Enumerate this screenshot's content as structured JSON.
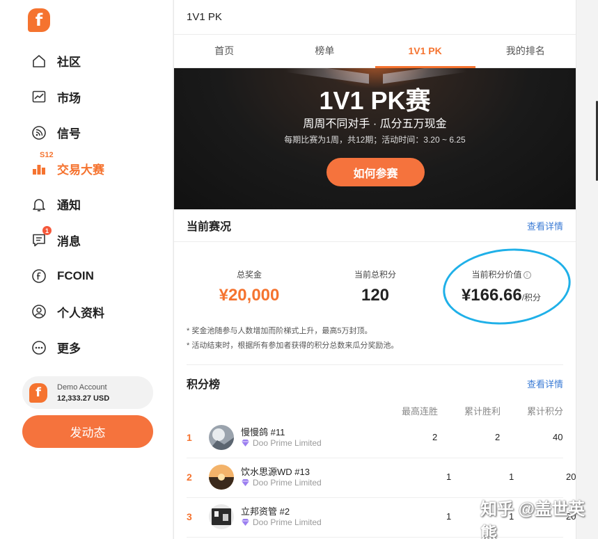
{
  "sidebar": {
    "logo_letter": "f",
    "items": [
      {
        "label": "社区",
        "icon": "home-icon"
      },
      {
        "label": "市场",
        "icon": "chart-icon"
      },
      {
        "label": "信号",
        "icon": "signal-icon"
      },
      {
        "label": "交易大赛",
        "icon": "bar-chart-icon",
        "active": true,
        "tag": "S12"
      },
      {
        "label": "通知",
        "icon": "bell-icon"
      },
      {
        "label": "消息",
        "icon": "message-icon",
        "badge": "1"
      },
      {
        "label": "FCOIN",
        "icon": "fcoin-icon"
      },
      {
        "label": "个人资料",
        "icon": "user-icon"
      },
      {
        "label": "更多",
        "icon": "more-icon"
      }
    ],
    "account": {
      "name": "Demo Account",
      "balance": "12,333.27 USD"
    },
    "post_button": "发动态"
  },
  "header": {
    "title": "1V1 PK"
  },
  "tabs": [
    {
      "label": "首页"
    },
    {
      "label": "榜单"
    },
    {
      "label": "1V1 PK",
      "active": true
    },
    {
      "label": "我的排名"
    }
  ],
  "banner": {
    "title": "1V1 PK赛",
    "subtitle": "周周不同对手 · 瓜分五万现金",
    "info": "每期比赛为1周，共12期；活动时间：3.20 ~ 6.25",
    "button": "如何参赛"
  },
  "status": {
    "title": "当前赛况",
    "link": "查看详情",
    "prize_label": "总奖金",
    "prize_value": "¥20,000",
    "points_label": "当前总积分",
    "points_value": "120",
    "value_label": "当前积分价值",
    "value_value": "¥166.66",
    "value_unit": "/积分",
    "notes": [
      "* 奖金池随参与人数增加而阶梯式上升，最高5万封顶。",
      "* 活动结束时，根据所有参加者获得的积分总数来瓜分奖励池。"
    ]
  },
  "leaderboard": {
    "title": "积分榜",
    "link": "查看详情",
    "columns": [
      "最高连胜",
      "累计胜利",
      "累计积分"
    ],
    "rows": [
      {
        "rank": "1",
        "name": "慢慢鸽 #11",
        "org": "Doo Prime Limited",
        "streak": "2",
        "wins": "2",
        "points": "40"
      },
      {
        "rank": "2",
        "name": "饮水思源WD #13",
        "org": "Doo Prime Limited",
        "streak": "1",
        "wins": "1",
        "points": "20"
      },
      {
        "rank": "3",
        "name": "立邦资管 #2",
        "org": "Doo Prime Limited",
        "streak": "1",
        "wins": "1",
        "points": "20"
      }
    ]
  },
  "watermark": "知乎 @盖世英熊",
  "colors": {
    "accent": "#f5732f",
    "link": "#3a7bd5",
    "highlight_circle": "#1fb0e8"
  }
}
